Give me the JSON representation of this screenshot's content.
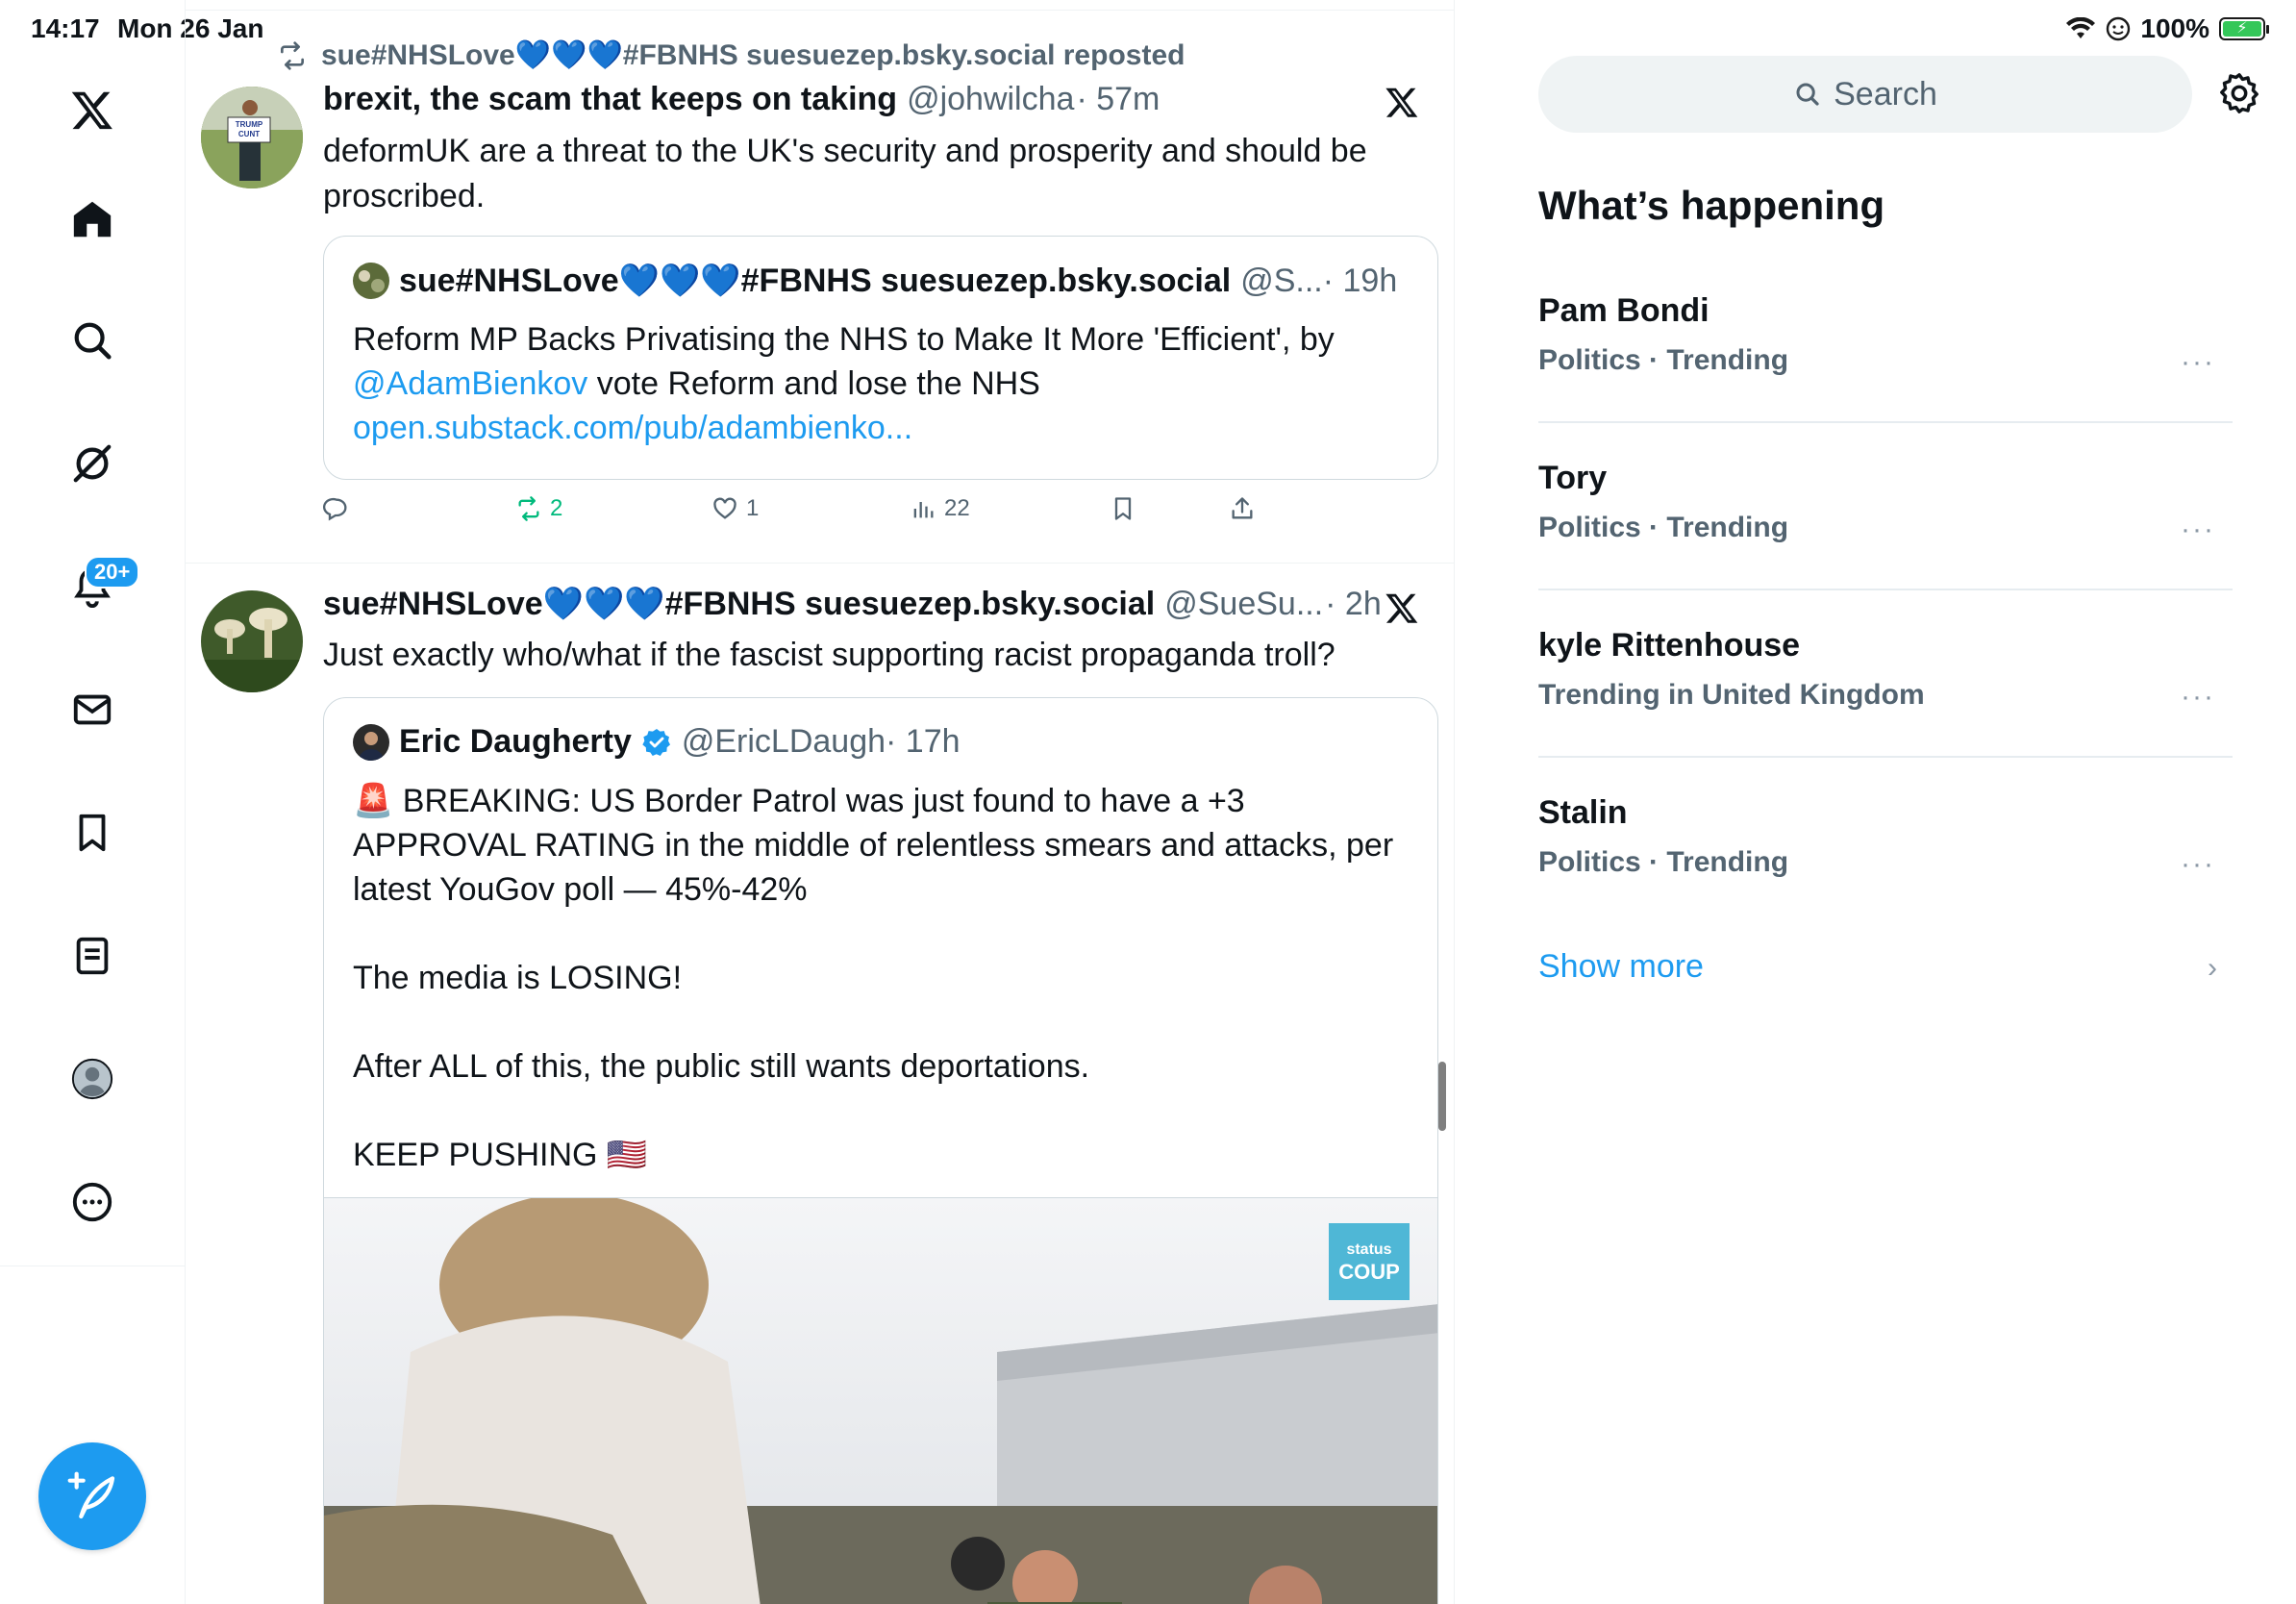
{
  "status_bar": {
    "time": "14:17",
    "date": "Mon 26 Jan",
    "battery": "100%"
  },
  "nav": {
    "items": [
      {
        "name": "x-logo-icon"
      },
      {
        "name": "home-icon"
      },
      {
        "name": "search-icon"
      },
      {
        "name": "grok-icon"
      },
      {
        "name": "notifications-icon"
      },
      {
        "name": "messages-icon"
      },
      {
        "name": "bookmarks-icon"
      },
      {
        "name": "lists-icon"
      },
      {
        "name": "profile-icon"
      },
      {
        "name": "more-icon"
      }
    ],
    "notification_badge": "20+",
    "compose_icon": "compose-post-icon"
  },
  "timeline": {
    "tweet1": {
      "repost_label": "sue#NHSLove💙💙💙#FBNHS suesuezep.bsky.social reposted",
      "name": "brexit, the scam that keeps on taking",
      "handle": "@johwilcha",
      "time": "· 57m",
      "text": "deformUK are a threat to the UK's security and prosperity and should be proscribed.",
      "quote": {
        "name": "sue#NHSLove💙💙💙#FBNHS suesuezep.bsky.social",
        "handle": "@S...",
        "time": "· 19h",
        "text_before": "Reform MP Backs Privatising the NHS to Make It More 'Efficient', by",
        "mention": "@AdamBienkov",
        "text_after": " vote Reform and lose the NHS",
        "link": "open.substack.com/pub/adambienko..."
      },
      "actions": {
        "reposts": "2",
        "likes": "1",
        "views": "22"
      }
    },
    "tweet2": {
      "name": "sue#NHSLove💙💙💙#FBNHS suesuezep.bsky.social",
      "handle": "@SueSu...",
      "time": "· 2h",
      "text": "Just exactly who/what if the fascist supporting racist propaganda troll?",
      "quote": {
        "name": "Eric Daugherty",
        "handle": "@EricLDaugh",
        "time": "· 17h",
        "line1": "🚨 BREAKING: US Border Patrol was just found to have a +3 APPROVAL RATING in the middle of relentless smears and attacks, per latest YouGov poll — 45%-42%",
        "line2": "The media is LOSING!",
        "line3": "After ALL of this, the public still wants deportations.",
        "line4": "KEEP PUSHING 🇺🇸",
        "media_watermark": "status COUP"
      }
    }
  },
  "sidebar": {
    "search_placeholder": "Search",
    "whats_happening": "What’s happening",
    "trends": [
      {
        "name": "Pam Bondi",
        "meta": "Politics · Trending"
      },
      {
        "name": "Tory",
        "meta": "Politics · Trending"
      },
      {
        "name": "kyle Rittenhouse",
        "meta": "Trending in United Kingdom"
      },
      {
        "name": "Stalin",
        "meta": "Politics · Trending"
      }
    ],
    "more_glyph": "···",
    "show_more": "Show more"
  },
  "colors": {
    "accent": "#1d9bf0",
    "repost_green": "#00ba7c",
    "text_primary": "#0f1419",
    "text_secondary": "#536471"
  }
}
